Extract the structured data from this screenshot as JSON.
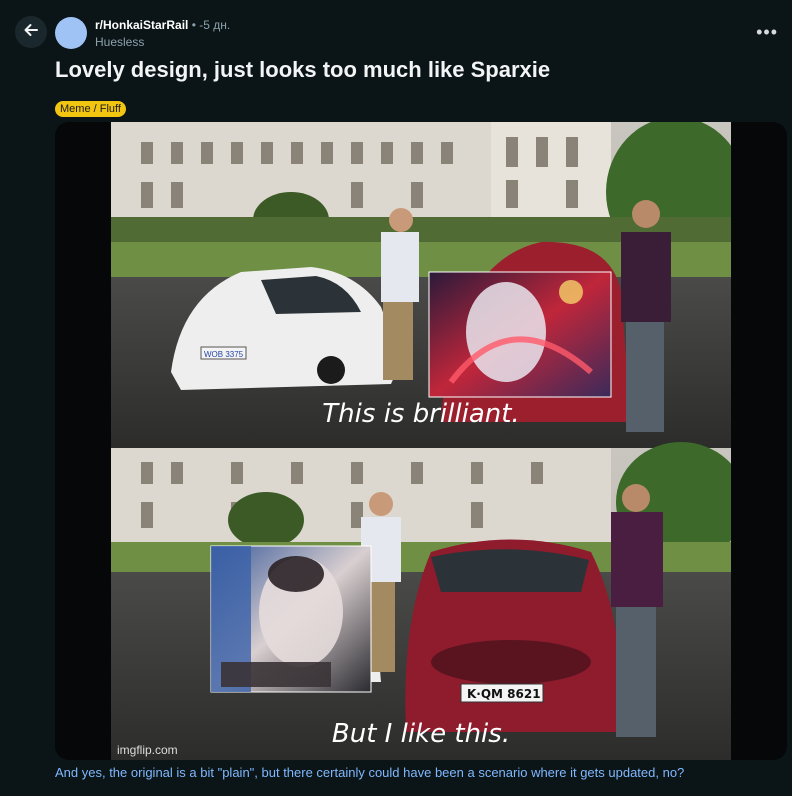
{
  "post": {
    "subreddit": "r/HonkaiStarRail",
    "separator": "•",
    "time_ago": "-5 дн.",
    "author": "Huesless",
    "title": "Lovely design, just looks too much like Sparxie",
    "flair": "Meme / Fluff",
    "body": "And yes, the original is a bit \"plain\", but there certainly could have been a scenario where it gets updated, no?"
  },
  "meme": {
    "top_caption": "This is brilliant.",
    "bottom_caption": "But I like this.",
    "watermark": "imgflip.com",
    "plate_top": "WOB 3375",
    "plate_bottom": "K·QM 8621"
  },
  "icons": {
    "back": "arrow-left-icon",
    "more": "more-options-icon"
  },
  "colors": {
    "background": "#0b1416",
    "flair_bg": "#f2c511",
    "body_text": "#7fb8ff"
  }
}
